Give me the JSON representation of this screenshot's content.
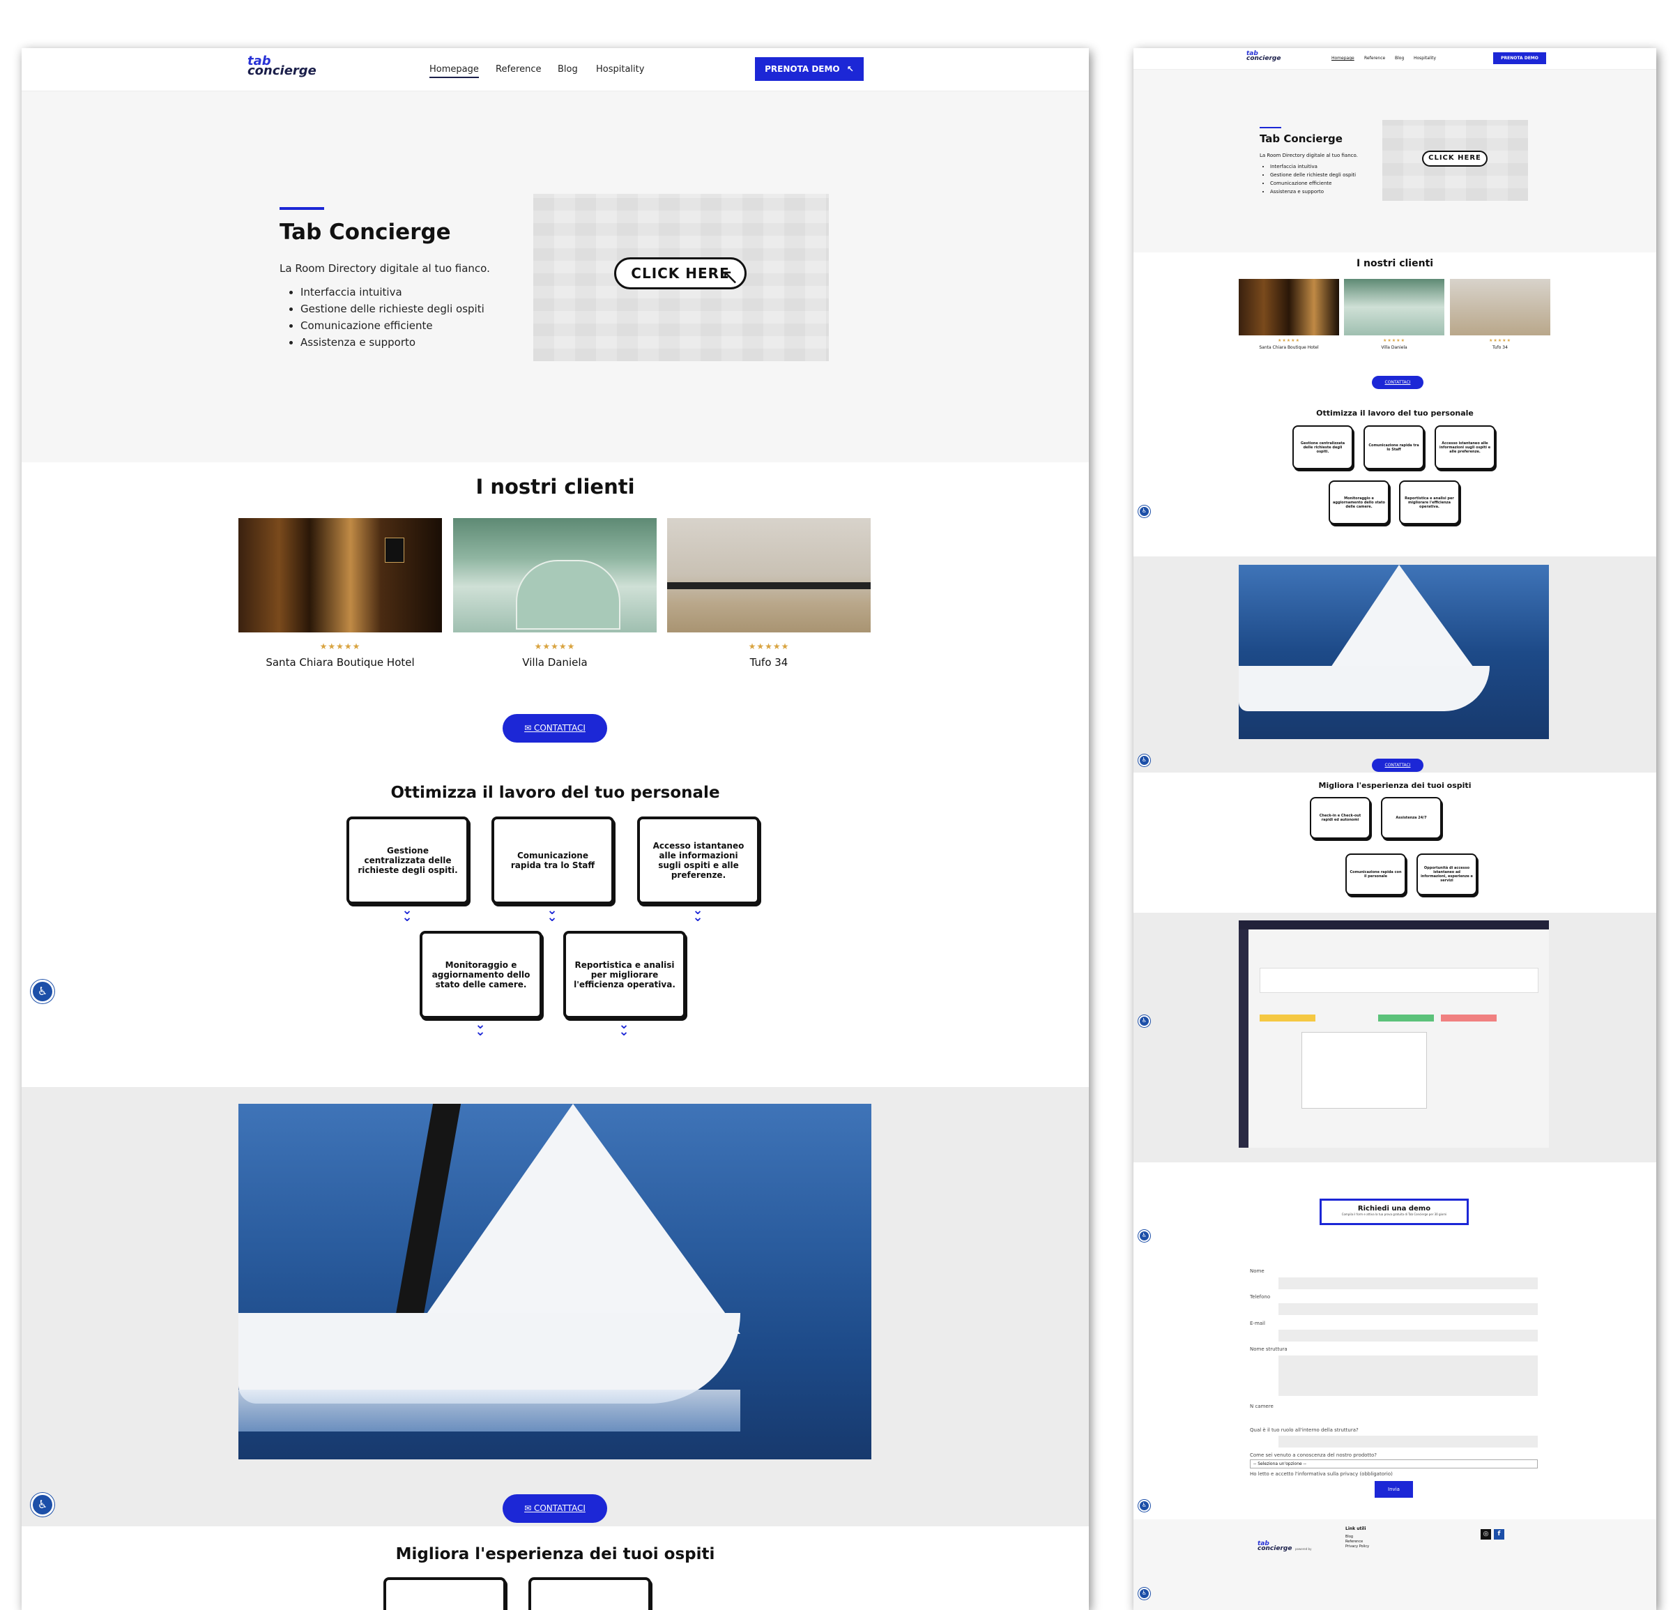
{
  "nav": {
    "logo_top": "tab",
    "logo_bottom": "concierge",
    "links": [
      "Homepage",
      "Reference",
      "Blog",
      "Hospitality"
    ],
    "demo_button": "PRENOTA DEMO"
  },
  "hero": {
    "title": "Tab Concierge",
    "subtitle": "La Room Directory digitale al tuo fianco.",
    "bullets": [
      "Interfaccia intuitiva",
      "Gestione delle richieste degli ospiti",
      "Comunicazione efficiente",
      "Assistenza e supporto"
    ],
    "click_label": "CLICK HERE"
  },
  "clients": {
    "heading": "I nostri clienti",
    "items": [
      {
        "name": "Santa Chiara Boutique Hotel",
        "rating": 5
      },
      {
        "name": "Villa Daniela",
        "rating": 5
      },
      {
        "name": "Tufo 34",
        "rating": 5
      }
    ],
    "stars": "★★★★★"
  },
  "contact_button": "CONTATTACI",
  "staff": {
    "heading": "Ottimizza il lavoro del tuo personale",
    "boxes": [
      "Gestione centralizzata delle richieste degli ospiti.",
      "Comunicazione rapida tra lo Staff",
      "Accesso istantaneo alle informazioni sugli ospiti e alle preferenze.",
      "Monitoraggio e aggiornamento dello stato delle camere.",
      "Reportistica e analisi per migliorare l'efficienza operativa."
    ]
  },
  "guests": {
    "heading": "Migliora l'esperienza dei tuoi ospiti",
    "boxes": [
      "Check-in e Check-out rapidi ed autonomi",
      "Assistenza 24/7",
      "Comunicazione rapida con il personale",
      "Opportunità di accesso istantaneo ad informazioni, esperienze e servizi"
    ]
  },
  "demo_form": {
    "title": "Richiedi una demo",
    "subtitle": "Compila il form e attiva la tua prova gratuita di Tab Concierge per 30 giorni",
    "fields": [
      "Nome",
      "Telefono",
      "E-mail",
      "Nome struttura",
      "N camere",
      "Qual è il tuo ruolo all'interno della struttura?",
      "Come sei venuto a conoscenza del nostro prodotto?"
    ],
    "select_placeholder": "-- Seleziona un'opzione --",
    "privacy": "Ho letto e accetto l'informativa sulla privacy (obbligatorio)",
    "submit": "Invia"
  },
  "footer": {
    "heading": "Link utili",
    "links": [
      "Blog",
      "Reference",
      "Privacy Policy"
    ],
    "powered": "powered by"
  },
  "colors": {
    "accent": "#1c27d6",
    "dark": "#1b1f4a",
    "star": "#d9a441",
    "hero_bg": "#f6f6f6",
    "section_gray": "#ececec"
  },
  "icons": [
    "accessibility-icon",
    "cursor-click-icon",
    "mail-icon",
    "chevron-down-icon",
    "instagram-icon",
    "facebook-icon"
  ]
}
